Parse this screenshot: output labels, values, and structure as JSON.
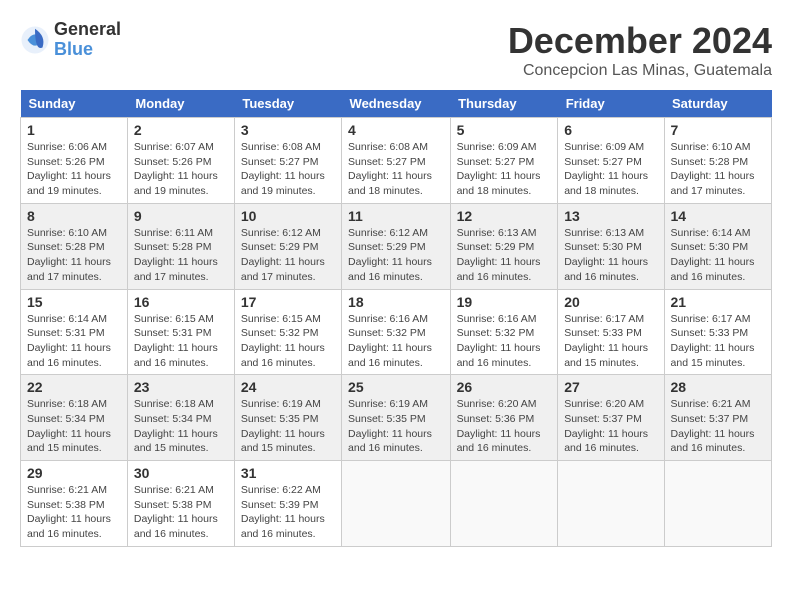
{
  "logo": {
    "general": "General",
    "blue": "Blue"
  },
  "title": "December 2024",
  "location": "Concepcion Las Minas, Guatemala",
  "headers": [
    "Sunday",
    "Monday",
    "Tuesday",
    "Wednesday",
    "Thursday",
    "Friday",
    "Saturday"
  ],
  "weeks": [
    [
      {
        "day": "1",
        "info": "Sunrise: 6:06 AM\nSunset: 5:26 PM\nDaylight: 11 hours\nand 19 minutes."
      },
      {
        "day": "2",
        "info": "Sunrise: 6:07 AM\nSunset: 5:26 PM\nDaylight: 11 hours\nand 19 minutes."
      },
      {
        "day": "3",
        "info": "Sunrise: 6:08 AM\nSunset: 5:27 PM\nDaylight: 11 hours\nand 19 minutes."
      },
      {
        "day": "4",
        "info": "Sunrise: 6:08 AM\nSunset: 5:27 PM\nDaylight: 11 hours\nand 18 minutes."
      },
      {
        "day": "5",
        "info": "Sunrise: 6:09 AM\nSunset: 5:27 PM\nDaylight: 11 hours\nand 18 minutes."
      },
      {
        "day": "6",
        "info": "Sunrise: 6:09 AM\nSunset: 5:27 PM\nDaylight: 11 hours\nand 18 minutes."
      },
      {
        "day": "7",
        "info": "Sunrise: 6:10 AM\nSunset: 5:28 PM\nDaylight: 11 hours\nand 17 minutes."
      }
    ],
    [
      {
        "day": "8",
        "info": "Sunrise: 6:10 AM\nSunset: 5:28 PM\nDaylight: 11 hours\nand 17 minutes."
      },
      {
        "day": "9",
        "info": "Sunrise: 6:11 AM\nSunset: 5:28 PM\nDaylight: 11 hours\nand 17 minutes."
      },
      {
        "day": "10",
        "info": "Sunrise: 6:12 AM\nSunset: 5:29 PM\nDaylight: 11 hours\nand 17 minutes."
      },
      {
        "day": "11",
        "info": "Sunrise: 6:12 AM\nSunset: 5:29 PM\nDaylight: 11 hours\nand 16 minutes."
      },
      {
        "day": "12",
        "info": "Sunrise: 6:13 AM\nSunset: 5:29 PM\nDaylight: 11 hours\nand 16 minutes."
      },
      {
        "day": "13",
        "info": "Sunrise: 6:13 AM\nSunset: 5:30 PM\nDaylight: 11 hours\nand 16 minutes."
      },
      {
        "day": "14",
        "info": "Sunrise: 6:14 AM\nSunset: 5:30 PM\nDaylight: 11 hours\nand 16 minutes."
      }
    ],
    [
      {
        "day": "15",
        "info": "Sunrise: 6:14 AM\nSunset: 5:31 PM\nDaylight: 11 hours\nand 16 minutes."
      },
      {
        "day": "16",
        "info": "Sunrise: 6:15 AM\nSunset: 5:31 PM\nDaylight: 11 hours\nand 16 minutes."
      },
      {
        "day": "17",
        "info": "Sunrise: 6:15 AM\nSunset: 5:32 PM\nDaylight: 11 hours\nand 16 minutes."
      },
      {
        "day": "18",
        "info": "Sunrise: 6:16 AM\nSunset: 5:32 PM\nDaylight: 11 hours\nand 16 minutes."
      },
      {
        "day": "19",
        "info": "Sunrise: 6:16 AM\nSunset: 5:32 PM\nDaylight: 11 hours\nand 16 minutes."
      },
      {
        "day": "20",
        "info": "Sunrise: 6:17 AM\nSunset: 5:33 PM\nDaylight: 11 hours\nand 15 minutes."
      },
      {
        "day": "21",
        "info": "Sunrise: 6:17 AM\nSunset: 5:33 PM\nDaylight: 11 hours\nand 15 minutes."
      }
    ],
    [
      {
        "day": "22",
        "info": "Sunrise: 6:18 AM\nSunset: 5:34 PM\nDaylight: 11 hours\nand 15 minutes."
      },
      {
        "day": "23",
        "info": "Sunrise: 6:18 AM\nSunset: 5:34 PM\nDaylight: 11 hours\nand 15 minutes."
      },
      {
        "day": "24",
        "info": "Sunrise: 6:19 AM\nSunset: 5:35 PM\nDaylight: 11 hours\nand 15 minutes."
      },
      {
        "day": "25",
        "info": "Sunrise: 6:19 AM\nSunset: 5:35 PM\nDaylight: 11 hours\nand 16 minutes."
      },
      {
        "day": "26",
        "info": "Sunrise: 6:20 AM\nSunset: 5:36 PM\nDaylight: 11 hours\nand 16 minutes."
      },
      {
        "day": "27",
        "info": "Sunrise: 6:20 AM\nSunset: 5:37 PM\nDaylight: 11 hours\nand 16 minutes."
      },
      {
        "day": "28",
        "info": "Sunrise: 6:21 AM\nSunset: 5:37 PM\nDaylight: 11 hours\nand 16 minutes."
      }
    ],
    [
      {
        "day": "29",
        "info": "Sunrise: 6:21 AM\nSunset: 5:38 PM\nDaylight: 11 hours\nand 16 minutes."
      },
      {
        "day": "30",
        "info": "Sunrise: 6:21 AM\nSunset: 5:38 PM\nDaylight: 11 hours\nand 16 minutes."
      },
      {
        "day": "31",
        "info": "Sunrise: 6:22 AM\nSunset: 5:39 PM\nDaylight: 11 hours\nand 16 minutes."
      },
      {
        "day": "",
        "info": ""
      },
      {
        "day": "",
        "info": ""
      },
      {
        "day": "",
        "info": ""
      },
      {
        "day": "",
        "info": ""
      }
    ]
  ]
}
